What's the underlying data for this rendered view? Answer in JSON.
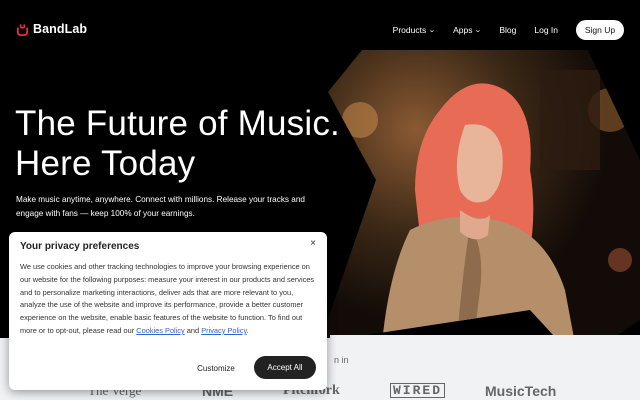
{
  "brand": {
    "name": "BandLab",
    "accent": "#f2333a"
  },
  "nav": {
    "items": [
      {
        "label": "Products",
        "has_dropdown": true
      },
      {
        "label": "Apps",
        "has_dropdown": true
      },
      {
        "label": "Blog",
        "has_dropdown": false
      },
      {
        "label": "Log In",
        "has_dropdown": false
      }
    ],
    "signup_label": "Sign Up",
    "chevron": "⌄"
  },
  "hero": {
    "title_line1": "The Future of Music.",
    "title_line2": "Here Today",
    "subtitle": "Make music anytime, anywhere. Connect with millions. Release your tracks and engage with fans — keep 100% of your earnings."
  },
  "featured": {
    "label": "n in",
    "press": [
      "The Verge",
      "NME",
      "Pitchfork",
      "WIRED",
      "MusicTech"
    ]
  },
  "cookie": {
    "title": "Your privacy preferences",
    "close_symbol": "×",
    "body_text": "We use cookies and other tracking technologies to improve your browsing experience on our website for the following purposes: measure your interest in our products and services and to personalize marketing interactions, deliver ads that are more relevant to you, analyze the use of the website and improve its performance, provide a better customer experience on the website, enable basic features of the website to function. To find out more or to opt-out, please read our ",
    "link1": "Cookies Policy",
    "and_text": " and ",
    "link2": "Privacy Policy",
    "end_text": ".",
    "customize_label": "Customize",
    "accept_label": "Accept All"
  }
}
